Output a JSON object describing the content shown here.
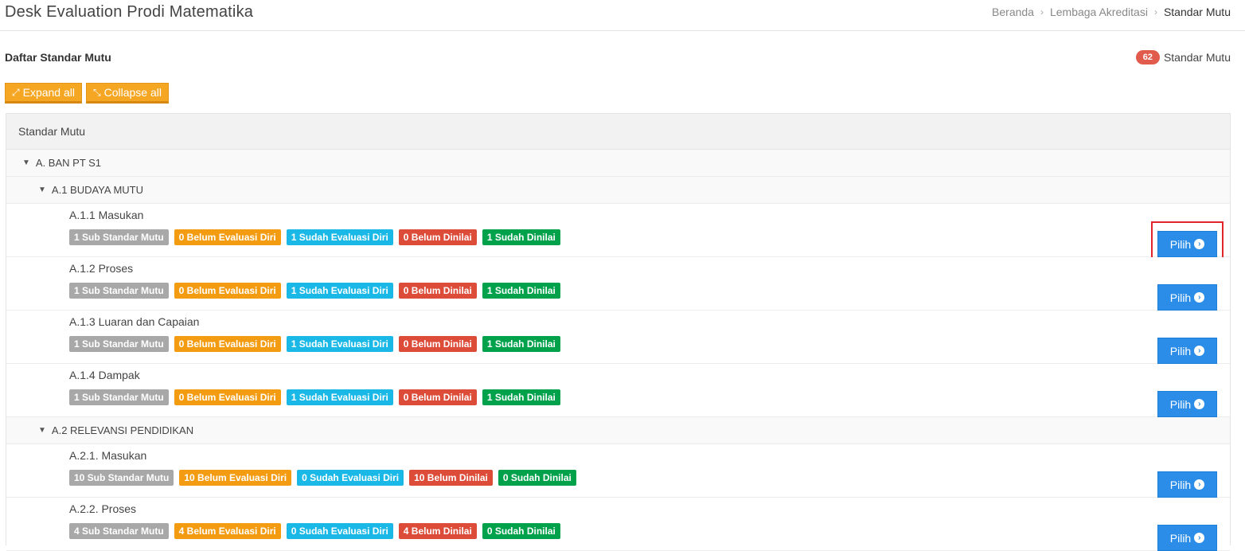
{
  "header": {
    "title": "Desk Evaluation Prodi Matematika",
    "breadcrumb": [
      "Beranda",
      "Lembaga Akreditasi",
      "Standar Mutu"
    ]
  },
  "list": {
    "title": "Daftar Standar Mutu",
    "count": "62",
    "count_label": "Standar Mutu"
  },
  "toolbar": {
    "expand_label": "Expand all",
    "collapse_label": "Collapse all"
  },
  "tree": {
    "header": "Standar Mutu",
    "root": "A. BAN PT S1",
    "group1": "A.1 BUDAYA MUTU",
    "group2": "A.2 RELEVANSI PENDIDIKAN",
    "button_label": "Pilih",
    "items": [
      {
        "title": "A.1.1 Masukan",
        "sub": "1 Sub Standar Mutu",
        "belum_eval": "0 Belum Evaluasi Diri",
        "sudah_eval": "1 Sudah Evaluasi Diri",
        "belum_nilai": "0 Belum Dinilai",
        "sudah_nilai": "1 Sudah Dinilai"
      },
      {
        "title": "A.1.2 Proses",
        "sub": "1 Sub Standar Mutu",
        "belum_eval": "0 Belum Evaluasi Diri",
        "sudah_eval": "1 Sudah Evaluasi Diri",
        "belum_nilai": "0 Belum Dinilai",
        "sudah_nilai": "1 Sudah Dinilai"
      },
      {
        "title": "A.1.3 Luaran dan Capaian",
        "sub": "1 Sub Standar Mutu",
        "belum_eval": "0 Belum Evaluasi Diri",
        "sudah_eval": "1 Sudah Evaluasi Diri",
        "belum_nilai": "0 Belum Dinilai",
        "sudah_nilai": "1 Sudah Dinilai"
      },
      {
        "title": "A.1.4 Dampak",
        "sub": "1 Sub Standar Mutu",
        "belum_eval": "0 Belum Evaluasi Diri",
        "sudah_eval": "1 Sudah Evaluasi Diri",
        "belum_nilai": "0 Belum Dinilai",
        "sudah_nilai": "1 Sudah Dinilai"
      },
      {
        "title": "A.2.1. Masukan",
        "sub": "10 Sub Standar Mutu",
        "belum_eval": "10 Belum Evaluasi Diri",
        "sudah_eval": "0 Sudah Evaluasi Diri",
        "belum_nilai": "10 Belum Dinilai",
        "sudah_nilai": "0 Sudah Dinilai"
      },
      {
        "title": "A.2.2. Proses",
        "sub": "4 Sub Standar Mutu",
        "belum_eval": "4 Belum Evaluasi Diri",
        "sudah_eval": "0 Sudah Evaluasi Diri",
        "belum_nilai": "4 Belum Dinilai",
        "sudah_nilai": "0 Sudah Dinilai"
      }
    ]
  },
  "colors": {
    "orange_button": "#f5a623",
    "blue_button": "#2b8de8",
    "highlight": "#e0252b"
  },
  "icons": [
    "expand-icon",
    "collapse-icon",
    "caret-down-icon",
    "chevron-circle-right-icon"
  ]
}
